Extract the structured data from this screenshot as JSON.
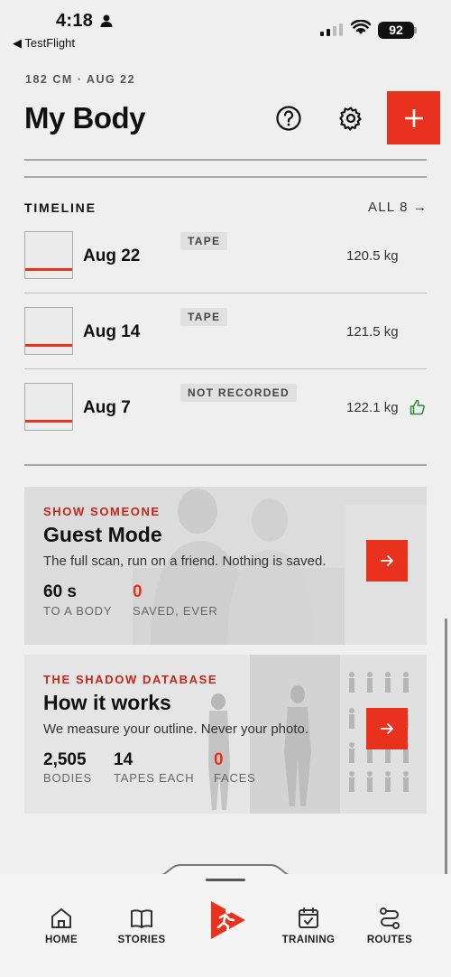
{
  "status": {
    "time": "4:18",
    "back": "◀ TestFlight",
    "battery": "92"
  },
  "header": {
    "subtitle": "182 CM · AUG 22",
    "title": "My Body"
  },
  "timeline": {
    "label": "TIMELINE",
    "all": "ALL 8 →",
    "rows": [
      {
        "date": "Aug 22",
        "tag": "TAPE",
        "weight": "120.5 kg"
      },
      {
        "date": "Aug 14",
        "tag": "TAPE",
        "weight": "121.5 kg"
      },
      {
        "date": "Aug 7",
        "tag": "NOT RECORDED",
        "weight": "122.1 kg"
      }
    ]
  },
  "guest_card": {
    "eyebrow": "SHOW SOMEONE",
    "title": "Guest Mode",
    "desc": "The full scan, run on a friend. Nothing is saved.",
    "stats": [
      {
        "num": "60 s",
        "label": "TO A BODY"
      },
      {
        "num": "0",
        "label": "SAVED, EVER"
      }
    ]
  },
  "shadow_card": {
    "eyebrow": "THE SHADOW DATABASE",
    "title": "How it works",
    "desc": "We measure your outline. Never your photo.",
    "stats": [
      {
        "num": "2,505",
        "label": "BODIES"
      },
      {
        "num": "14",
        "label": "TAPES EACH"
      },
      {
        "num": "0",
        "label": "FACES"
      }
    ]
  },
  "nav": {
    "items": [
      {
        "label": "HOME"
      },
      {
        "label": "STORIES"
      },
      {
        "label": "TRAINING"
      },
      {
        "label": "ROUTES"
      }
    ]
  },
  "colors": {
    "accent": "#e8321d",
    "background": "#efefef"
  }
}
